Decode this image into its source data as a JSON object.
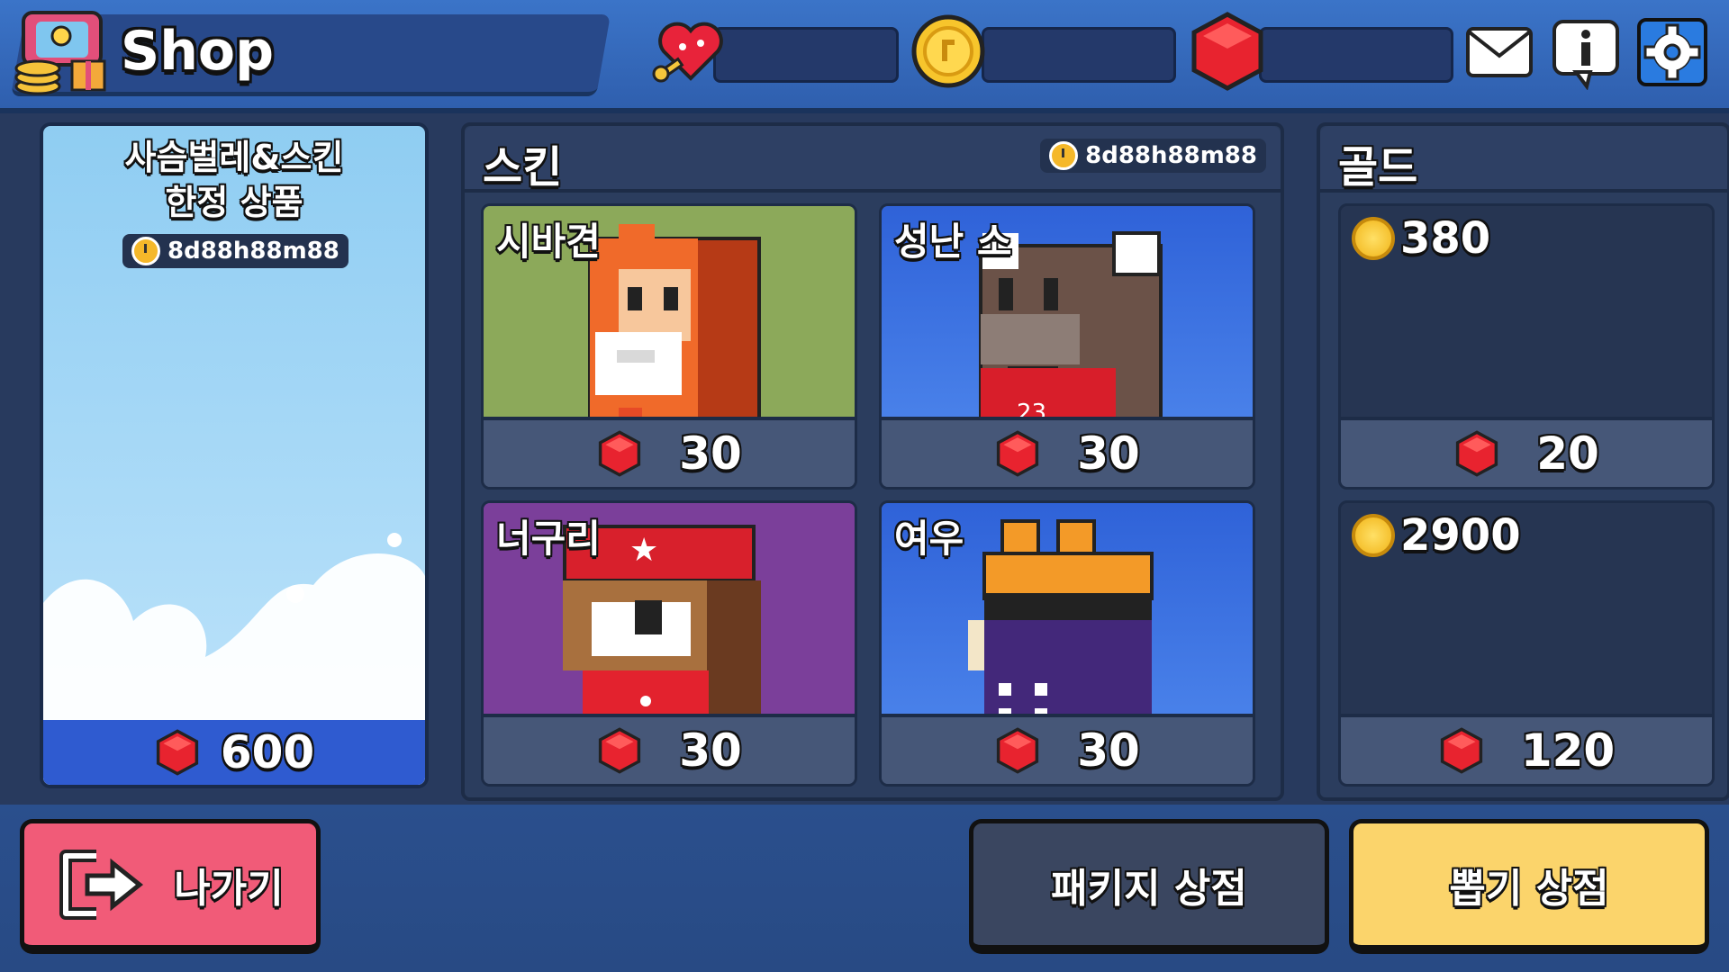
{
  "header": {
    "title": "Shop",
    "resources": [
      {
        "icon": "heart-key-icon",
        "value": ""
      },
      {
        "icon": "gold-coin-icon",
        "value": ""
      },
      {
        "icon": "ruby-gem-icon",
        "value": ""
      }
    ],
    "buttons": [
      "mail-icon",
      "info-icon",
      "gear-icon"
    ]
  },
  "promo": {
    "title_line1": "사슴벌레&스킨",
    "title_line2": "한정 상품",
    "timer": "8d88h88m88",
    "price": "600"
  },
  "skins": {
    "title": "스킨",
    "timer": "8d88h88m88",
    "items": [
      {
        "name": "시바견",
        "price": "30"
      },
      {
        "name": "성난 소",
        "price": "30"
      },
      {
        "name": "너구리",
        "price": "30"
      },
      {
        "name": "여우",
        "price": "30"
      }
    ]
  },
  "gold": {
    "title": "골드",
    "items": [
      {
        "amount": "380",
        "price": "20"
      },
      {
        "amount": "2900",
        "price": "120"
      }
    ]
  },
  "bottom": {
    "exit_label": "나가기",
    "package_label": "패키지 상점",
    "gacha_label": "뽑기 상점"
  },
  "colors": {
    "topbar": "#3b74c8",
    "gem": "#e8232f",
    "exit_button": "#f15b78",
    "gacha_button": "#fbd46b",
    "package_button": "#3a4660"
  }
}
